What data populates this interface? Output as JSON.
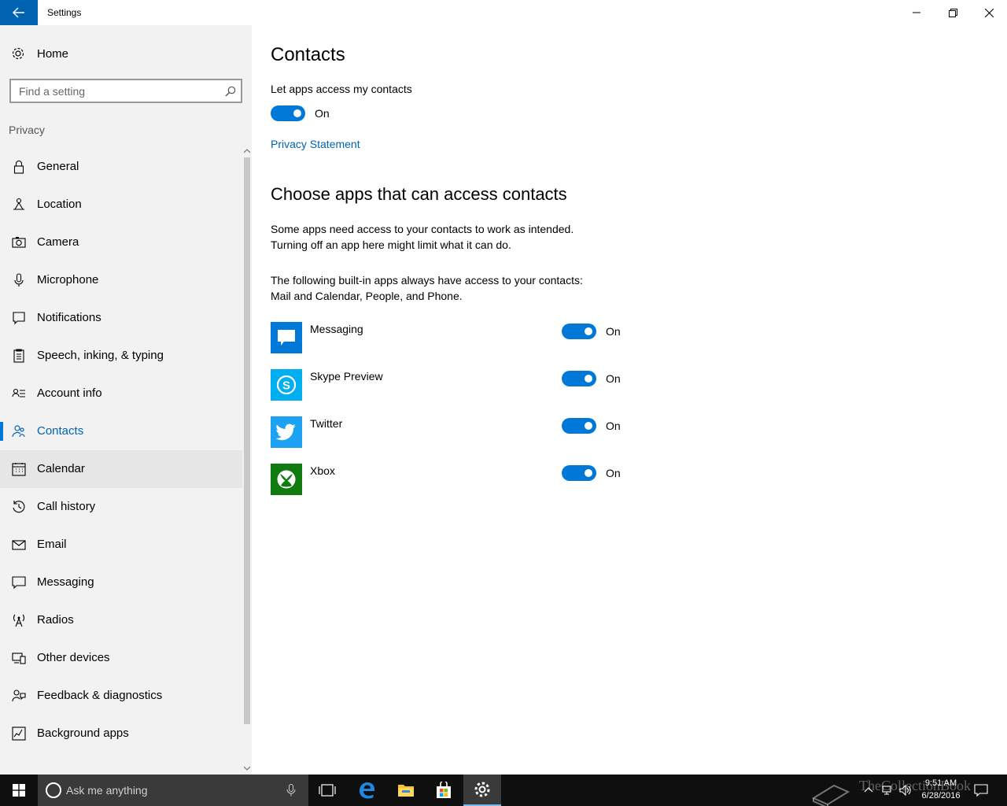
{
  "window": {
    "title": "Settings"
  },
  "sidebar": {
    "home_label": "Home",
    "search_placeholder": "Find a setting",
    "group_label": "Privacy",
    "items": [
      {
        "label": "General",
        "icon": "lock-icon"
      },
      {
        "label": "Location",
        "icon": "location-icon"
      },
      {
        "label": "Camera",
        "icon": "camera-icon"
      },
      {
        "label": "Microphone",
        "icon": "microphone-icon"
      },
      {
        "label": "Notifications",
        "icon": "notifications-icon"
      },
      {
        "label": "Speech, inking, & typing",
        "icon": "speech-icon"
      },
      {
        "label": "Account info",
        "icon": "account-info-icon"
      },
      {
        "label": "Contacts",
        "icon": "contacts-icon"
      },
      {
        "label": "Calendar",
        "icon": "calendar-icon"
      },
      {
        "label": "Call history",
        "icon": "history-icon"
      },
      {
        "label": "Email",
        "icon": "email-icon"
      },
      {
        "label": "Messaging",
        "icon": "messaging-icon"
      },
      {
        "label": "Radios",
        "icon": "radios-icon"
      },
      {
        "label": "Other devices",
        "icon": "devices-icon"
      },
      {
        "label": "Feedback & diagnostics",
        "icon": "feedback-icon"
      },
      {
        "label": "Background apps",
        "icon": "background-apps-icon"
      }
    ],
    "selected": "Contacts",
    "hovered": "Calendar"
  },
  "main": {
    "title": "Contacts",
    "access_label": "Let apps access my contacts",
    "access_state": "On",
    "privacy_link": "Privacy Statement",
    "section_title": "Choose apps that can access contacts",
    "para1_line1": "Some apps need access to your contacts to work as intended.",
    "para1_line2": "Turning off an app here might limit what it can do.",
    "para2_line1": "The following built-in apps always have access to your contacts:",
    "para2_line2": "Mail and Calendar, People, and Phone.",
    "apps": [
      {
        "name": "Messaging",
        "state": "On",
        "color": "#0078d7"
      },
      {
        "name": "Skype Preview",
        "state": "On",
        "color": "#00aff0"
      },
      {
        "name": "Twitter",
        "state": "On",
        "color": "#1da1f2"
      },
      {
        "name": "Xbox",
        "state": "On",
        "color": "#107c10"
      }
    ]
  },
  "taskbar": {
    "search_placeholder": "Ask me anything",
    "time": "9:51 AM",
    "date": "6/28/2016",
    "watermark": "TheCollectionBook"
  },
  "colors": {
    "accent": "#0078d7",
    "link": "#0063b1",
    "sidebar_bg": "#f2f2f2",
    "taskbar_bg": "#0f0f0f"
  }
}
